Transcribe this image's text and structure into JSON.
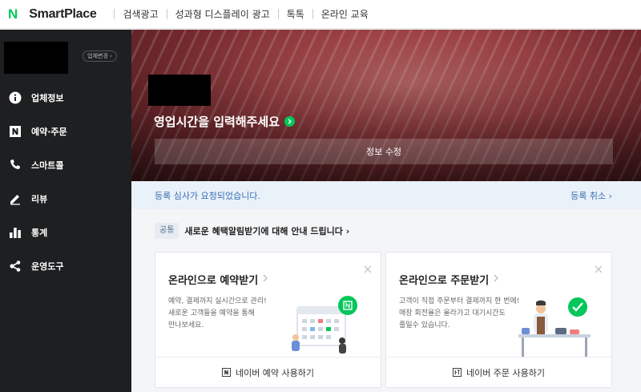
{
  "app": {
    "brand_mark": "N",
    "brand_name": "SmartPlace"
  },
  "topnav": {
    "items": [
      {
        "label": "검색광고"
      },
      {
        "label": "성과형 디스플레이 광고"
      },
      {
        "label": "톡톡"
      },
      {
        "label": "온라인 교육"
      }
    ]
  },
  "sidebar": {
    "business_change_label": "업체변경 ›",
    "items": [
      {
        "label": "업체정보",
        "icon": "info-icon"
      },
      {
        "label": "예약·주문",
        "icon": "naver-n-icon"
      },
      {
        "label": "스마트콜",
        "icon": "phone-icon"
      },
      {
        "label": "리뷰",
        "icon": "pencil-icon"
      },
      {
        "label": "통계",
        "icon": "bar-chart-icon"
      },
      {
        "label": "운영도구",
        "icon": "share-nodes-icon"
      }
    ]
  },
  "hero": {
    "hours_prompt": "영업시간을 입력해주세요",
    "edit_button": "정보 수정"
  },
  "notice": {
    "text": "등록 심사가 요청되었습니다.",
    "cancel_label": "등록 취소 ›"
  },
  "announce": {
    "badge": "공통",
    "text": "새로운 혜택알림받기에 대해 안내 드립니다 ›"
  },
  "cards": [
    {
      "title": "온라인으로 예약받기",
      "desc": [
        "예약, 결제까지 실시간으로 관리!",
        "새로운 고객들을 예약을 통해",
        "만나보세요."
      ],
      "footer": "네이버 예약 사용하기"
    },
    {
      "title": "온라인으로 주문받기",
      "desc": [
        "고객이 직접 주문부터 결제까지 한 번에!",
        "매장 회전율은 올라가고 대기시간도",
        "줄일수 있습니다."
      ],
      "footer": "네이버 주문 사용하기"
    }
  ],
  "colors": {
    "brand_green": "#03c75a",
    "sidebar_bg": "#1e1f21",
    "notice_blue": "#3b6fb5"
  }
}
